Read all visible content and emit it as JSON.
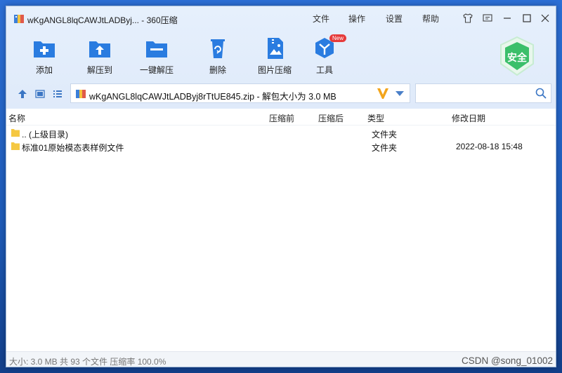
{
  "window": {
    "title": "wKgANGL8lqCAWJtLADByj... - 360压缩",
    "menus": [
      "文件",
      "操作",
      "设置",
      "帮助"
    ]
  },
  "toolbar": {
    "items": [
      {
        "label": "添加",
        "icon": "add-icon"
      },
      {
        "label": "解压到",
        "icon": "extract-to-icon"
      },
      {
        "label": "一键解压",
        "icon": "one-click-extract-icon"
      },
      {
        "label": "删除",
        "icon": "delete-icon"
      },
      {
        "label": "图片压缩",
        "icon": "image-compress-icon"
      },
      {
        "label": "工具",
        "icon": "tools-icon",
        "badge": "New"
      }
    ],
    "safe_label": "安全"
  },
  "address": {
    "path": "wKgANGL8lqCAWJtLADByj8rTtUE845.zip - 解包大小为 3.0 MB",
    "search_placeholder": ""
  },
  "columns": [
    "名称",
    "压缩前",
    "压缩后",
    "类型",
    "修改日期"
  ],
  "rows": [
    {
      "name": ".. (上级目录)",
      "type": "文件夹",
      "date": ""
    },
    {
      "name": "标准01原始模态表样例文件",
      "type": "文件夹",
      "date": "2022-08-18 15:48"
    }
  ],
  "status": {
    "text": "大小: 3.0 MB 共 93 个文件 压缩率 100.0%",
    "watermark": "CSDN @song_01002"
  },
  "colors": {
    "accent": "#2a7ce0",
    "safe_green": "#3bbf6a",
    "badge_red": "#e63b3b",
    "folder_yellow": "#f5c842"
  }
}
